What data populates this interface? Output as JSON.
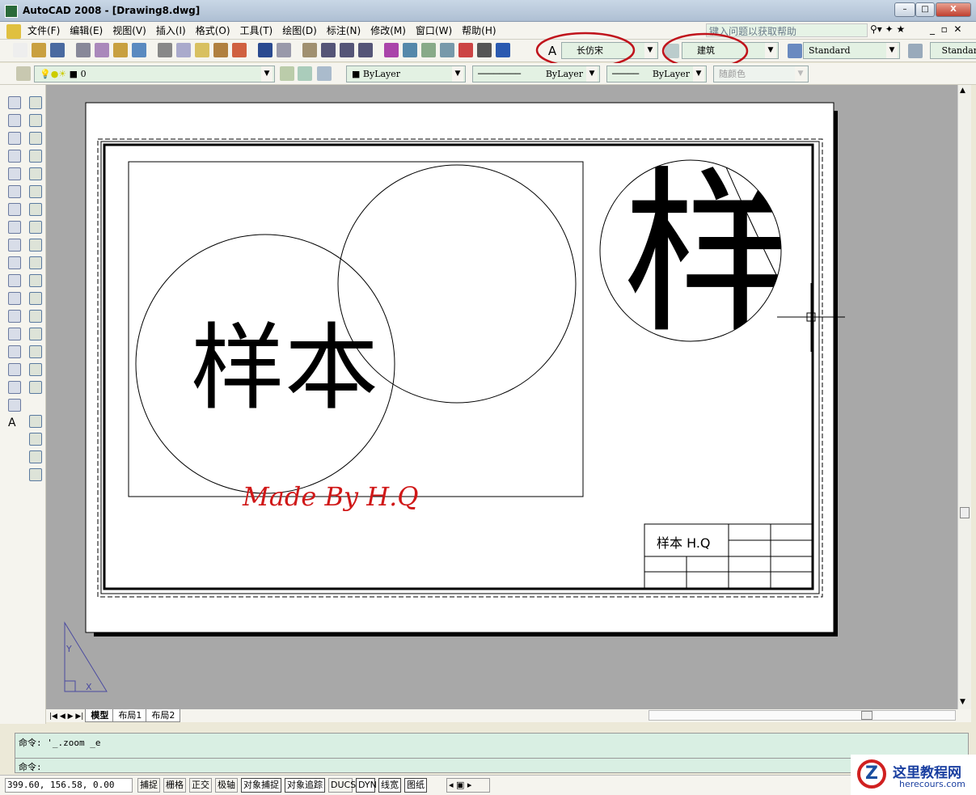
{
  "window": {
    "title": "AutoCAD 2008 - [Drawing8.dwg]",
    "minimize": "–",
    "maximize": "□",
    "close": "X"
  },
  "menu": [
    "文件(F)",
    "编辑(E)",
    "视图(V)",
    "插入(I)",
    "格式(O)",
    "工具(T)",
    "绘图(D)",
    "标注(N)",
    "修改(M)",
    "窗口(W)",
    "帮助(H)"
  ],
  "help_placeholder": "键入问题以获取帮助",
  "toolbar1": {
    "icons": [
      "new-icon",
      "open-icon",
      "save-icon",
      "plot-icon",
      "plot-preview-icon",
      "publish-icon",
      "3d-dwf-icon",
      "cut-icon",
      "copy-icon",
      "paste-icon",
      "match-properties-icon",
      "block-editor-icon",
      "undo-icon",
      "redo-icon",
      "pan-icon",
      "zoom-realtime-icon",
      "zoom-window-icon",
      "zoom-previous-icon",
      "properties-icon",
      "design-center-icon",
      "tool-palettes-icon",
      "sheet-set-icon",
      "markup-icon",
      "calculator-icon",
      "help-icon"
    ],
    "text_style": "长仿宋",
    "dim_style": "建筑",
    "table_style": "Standard",
    "multileader_style": "Standar"
  },
  "toolbar2": {
    "layer": "0",
    "color": "ByLayer",
    "linetype": "ByLayer",
    "lineweight": "ByLayer",
    "plot_style": "随颜色"
  },
  "left_tools": [
    "line-icon",
    "construction-line-icon",
    "polyline-icon",
    "polygon-icon",
    "rectangle-icon",
    "arc-icon",
    "circle-icon",
    "revision-cloud-icon",
    "spline-icon",
    "ellipse-icon",
    "ellipse-arc-icon",
    "insert-block-icon",
    "make-block-icon",
    "point-icon",
    "hatch-icon",
    "gradient-icon",
    "region-icon",
    "table-icon",
    "multiline-text-icon"
  ],
  "modify_tools": [
    "erase-icon",
    "copy-object-icon",
    "mirror-icon",
    "offset-icon",
    "array-icon",
    "move-icon",
    "rotate-icon",
    "scale-icon",
    "stretch-icon",
    "trim-icon",
    "extend-icon",
    "break-at-point-icon",
    "break-icon",
    "join-icon",
    "chamfer-icon",
    "fillet-icon",
    "explode-icon",
    "draworder-front-icon",
    "draworder-back-icon",
    "draworder-above-icon",
    "draworder-under-icon"
  ],
  "drawing": {
    "big_text": "样本",
    "signature": "Made By H.Q",
    "titleblock_text": "样本 H.Q",
    "ucs_y": "Y",
    "ucs_x": "X"
  },
  "tabs": [
    "模型",
    "布局1",
    "布局2"
  ],
  "command": {
    "line1": "命令: '_.zoom _e",
    "line2": "命令:"
  },
  "status": {
    "coords": "399.60, 156.58, 0.00",
    "buttons": [
      {
        "label": "捕捉",
        "on": false
      },
      {
        "label": "栅格",
        "on": false
      },
      {
        "label": "正交",
        "on": false
      },
      {
        "label": "极轴",
        "on": false
      },
      {
        "label": "对象捕捉",
        "on": true
      },
      {
        "label": "对象追踪",
        "on": true
      },
      {
        "label": "DUCS",
        "on": false
      },
      {
        "label": "DYN",
        "on": true
      },
      {
        "label": "线宽",
        "on": true
      },
      {
        "label": "图纸",
        "on": true
      }
    ]
  },
  "watermark": {
    "name": "这里教程网",
    "url": "herecours.com"
  },
  "colors": {
    "highlight": "#c0141c",
    "signature": "#d01818",
    "ucs": "#4a4aa0"
  }
}
